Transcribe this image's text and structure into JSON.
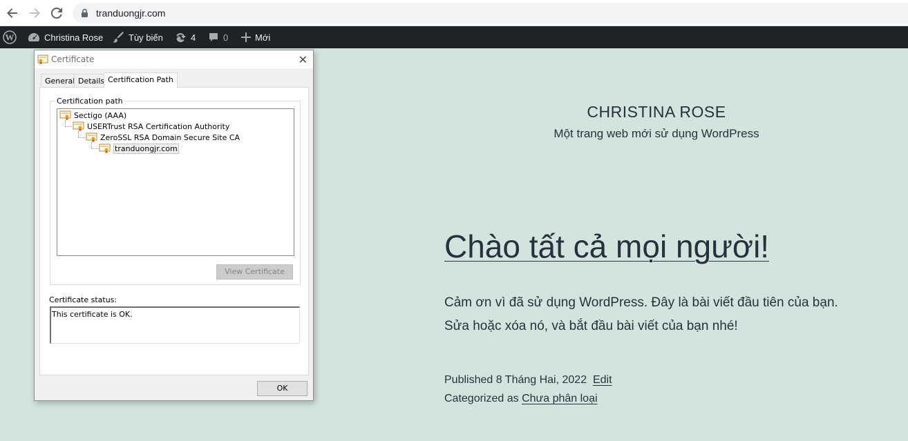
{
  "browser": {
    "url": "tranduongjr.com"
  },
  "admin_bar": {
    "site_name": "Christina Rose",
    "customize": "Tùy biến",
    "updates_count": "4",
    "comments_count": "0",
    "new_label": "Mới"
  },
  "site": {
    "title": "CHRISTINA ROSE",
    "description": "Một trang web mới sử dụng WordPress"
  },
  "post": {
    "title": "Chào tất cả mọi người!",
    "body_line1": "Cảm ơn vì đã sử dụng WordPress. Đây là bài viết đầu tiên của bạn.",
    "body_line2": "Sửa hoặc xóa nó, và bắt đầu bài viết của bạn nhé!",
    "published_label": "Published",
    "published_date": "8 Tháng Hai, 2022",
    "edit_link": "Edit",
    "categorized_label": "Categorized as",
    "category": "Chưa phân loại"
  },
  "dialog": {
    "title": "Certificate",
    "tabs": [
      "General",
      "Details",
      "Certification Path"
    ],
    "active_tab": "Certification Path",
    "path_group_label": "Certification path",
    "path": [
      "Sectigo (AAA)",
      "USERTrust RSA Certification Authority",
      "ZeroSSL RSA Domain Secure Site CA",
      "tranduongjr.com"
    ],
    "view_certificate_button": "View Certificate",
    "status_label": "Certificate status:",
    "status_text": "This certificate is OK.",
    "ok_button": "OK"
  },
  "colors": {
    "page_bg": "#d1e4dd",
    "admin_bar_bg": "#1d2327",
    "text_dark": "#28303d"
  }
}
